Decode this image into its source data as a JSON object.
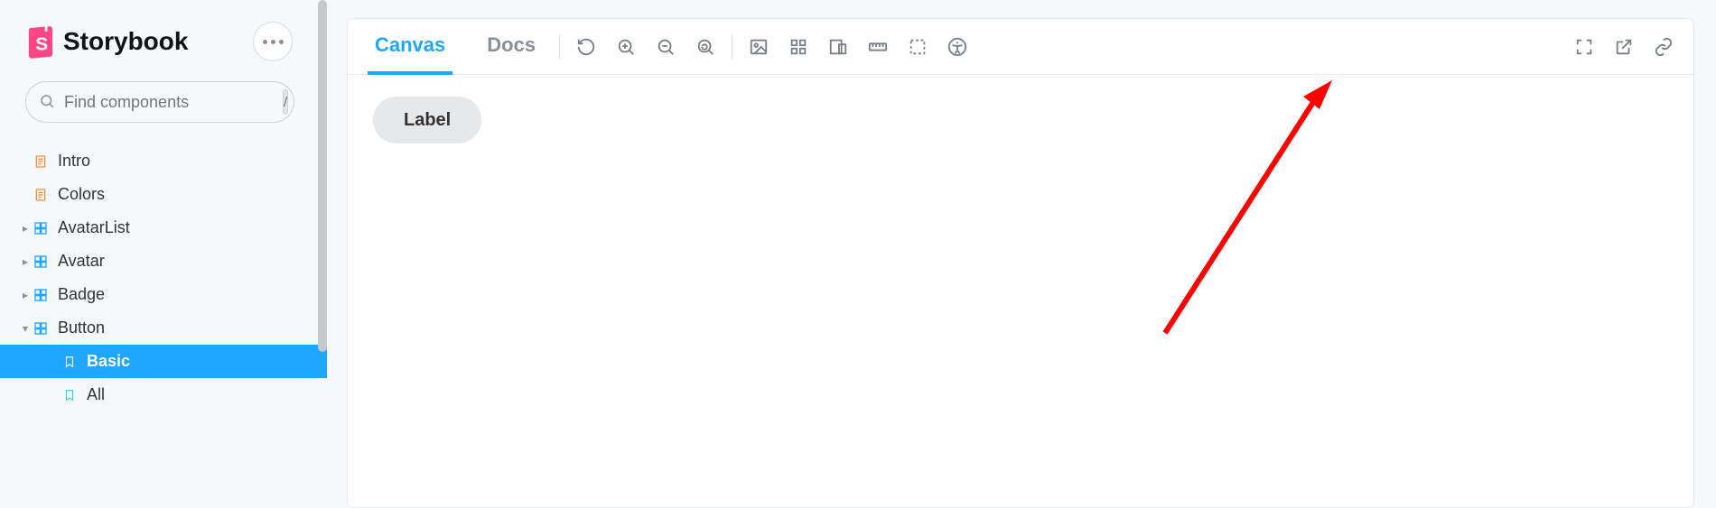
{
  "brand": {
    "name": "Storybook"
  },
  "search": {
    "placeholder": "Find components",
    "shortcut": "/"
  },
  "sidebar": {
    "items": [
      {
        "kind": "doc",
        "label": "Intro"
      },
      {
        "kind": "doc",
        "label": "Colors"
      },
      {
        "kind": "component",
        "label": "AvatarList",
        "expanded": false
      },
      {
        "kind": "component",
        "label": "Avatar",
        "expanded": false
      },
      {
        "kind": "component",
        "label": "Badge",
        "expanded": false
      },
      {
        "kind": "component",
        "label": "Button",
        "expanded": true
      },
      {
        "kind": "story",
        "label": "Basic",
        "selected": true
      },
      {
        "kind": "story",
        "label": "All"
      }
    ]
  },
  "tabs": {
    "canvas": "Canvas",
    "docs": "Docs",
    "active": "canvas"
  },
  "toolbar_icons": {
    "reload": "reload",
    "zoom_in": "zoom-in",
    "zoom_out": "zoom-out",
    "zoom_reset": "zoom-reset",
    "background": "background",
    "grid": "grid",
    "viewport": "viewport",
    "measure": "measure",
    "outline": "outline",
    "accessibility": "accessibility",
    "fullscreen": "fullscreen",
    "open_new": "open-in-new-tab",
    "copy_link": "copy-link"
  },
  "preview": {
    "button_label": "Label"
  },
  "annotation": {
    "arrow_target": "open-in-new-tab"
  }
}
